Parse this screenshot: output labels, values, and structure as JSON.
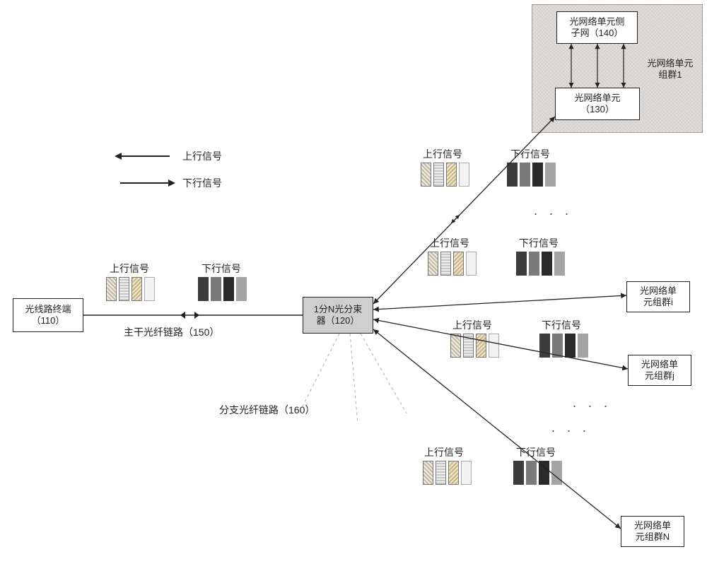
{
  "legend": {
    "upstream": "上行信号",
    "downstream": "下行信号"
  },
  "nodes": {
    "olt": {
      "line1": "光线路终端",
      "ref": "（110）"
    },
    "splitter": {
      "line1": "1分N光分束",
      "line2": "器（120）"
    },
    "onu": {
      "line1": "光网络单元",
      "ref": "（130）"
    },
    "onu_subnet": {
      "line1": "光网络单元侧",
      "line2": "子网（140）"
    },
    "group_label_top": {
      "line1": "光网络单元",
      "line2": "组群1"
    },
    "group_i": {
      "line1": "光网络单",
      "line2": "元组群i"
    },
    "group_j": {
      "line1": "光网络单",
      "line2": "元组群j"
    },
    "group_N": {
      "line1": "光网络单",
      "line2": "元组群N"
    }
  },
  "links": {
    "trunk": "主干光纤链路（150）",
    "branch": "分支光纤链路（160）"
  },
  "pair_labels": {
    "up": "上行信号",
    "down": "下行信号"
  }
}
